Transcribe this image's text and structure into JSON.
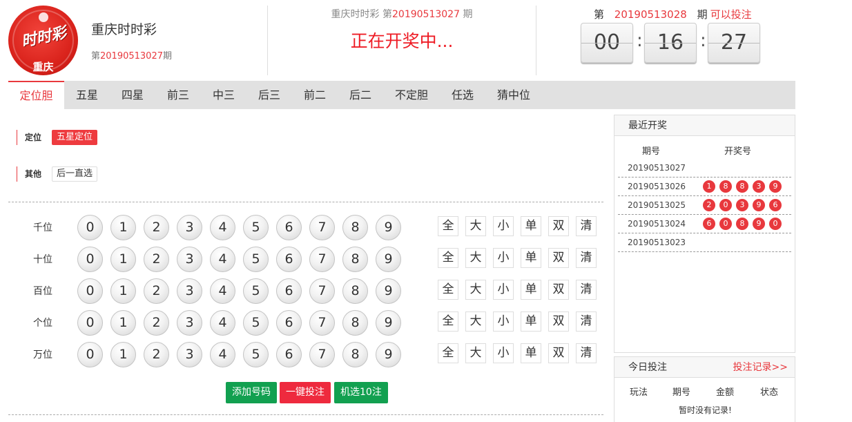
{
  "header": {
    "logo_text": "时时彩",
    "logo_region": "重庆",
    "lottery_name": "重庆时时彩",
    "cur_issue_prefix": "第",
    "cur_issue_no": "20190513027",
    "cur_issue_suffix": "期",
    "mid_title_prefix": "重庆时时彩 第",
    "mid_issue_no": "20190513027",
    "mid_title_suffix": "期",
    "drawing_status": "正在开奖中...",
    "next_prefix": "第",
    "next_issue_no": "20190513028",
    "next_suffix": "期",
    "next_status": "可以投注",
    "countdown": {
      "hh": "00",
      "mm": "16",
      "ss": "27",
      "sep": ":"
    }
  },
  "tabs": [
    "定位胆",
    "五星",
    "四星",
    "前三",
    "中三",
    "后三",
    "前二",
    "后二",
    "不定胆",
    "任选",
    "猜中位"
  ],
  "play_groups": [
    {
      "label": "定位",
      "options": [
        "五星定位"
      ]
    },
    {
      "label": "其他",
      "options": [
        "后一直选"
      ]
    }
  ],
  "digit_rows": [
    "千位",
    "十位",
    "百位",
    "个位",
    "万位"
  ],
  "digits": [
    "0",
    "1",
    "2",
    "3",
    "4",
    "5",
    "6",
    "7",
    "8",
    "9"
  ],
  "quick_picks": [
    "全",
    "大",
    "小",
    "单",
    "双",
    "清"
  ],
  "actions": {
    "add": "添加号码",
    "one_click": "一键投注",
    "random": "机选10注"
  },
  "recent": {
    "title": "最近开奖",
    "col_issue": "期号",
    "col_numbers": "开奖号",
    "rows": [
      {
        "issue": "20190513027",
        "nums": []
      },
      {
        "issue": "20190513026",
        "nums": [
          "1",
          "8",
          "8",
          "3",
          "9"
        ]
      },
      {
        "issue": "20190513025",
        "nums": [
          "2",
          "0",
          "3",
          "9",
          "6"
        ]
      },
      {
        "issue": "20190513024",
        "nums": [
          "6",
          "0",
          "8",
          "9",
          "0"
        ]
      },
      {
        "issue": "20190513023",
        "nums": []
      }
    ]
  },
  "today": {
    "title": "今日投注",
    "link": "投注记录>>",
    "cols": [
      "玩法",
      "期号",
      "金额",
      "状态"
    ],
    "empty": "暂时没有记录!"
  },
  "colors": {
    "accent": "#e8383d",
    "green": "#12a050",
    "tab_bg": "#e1e1e1"
  }
}
